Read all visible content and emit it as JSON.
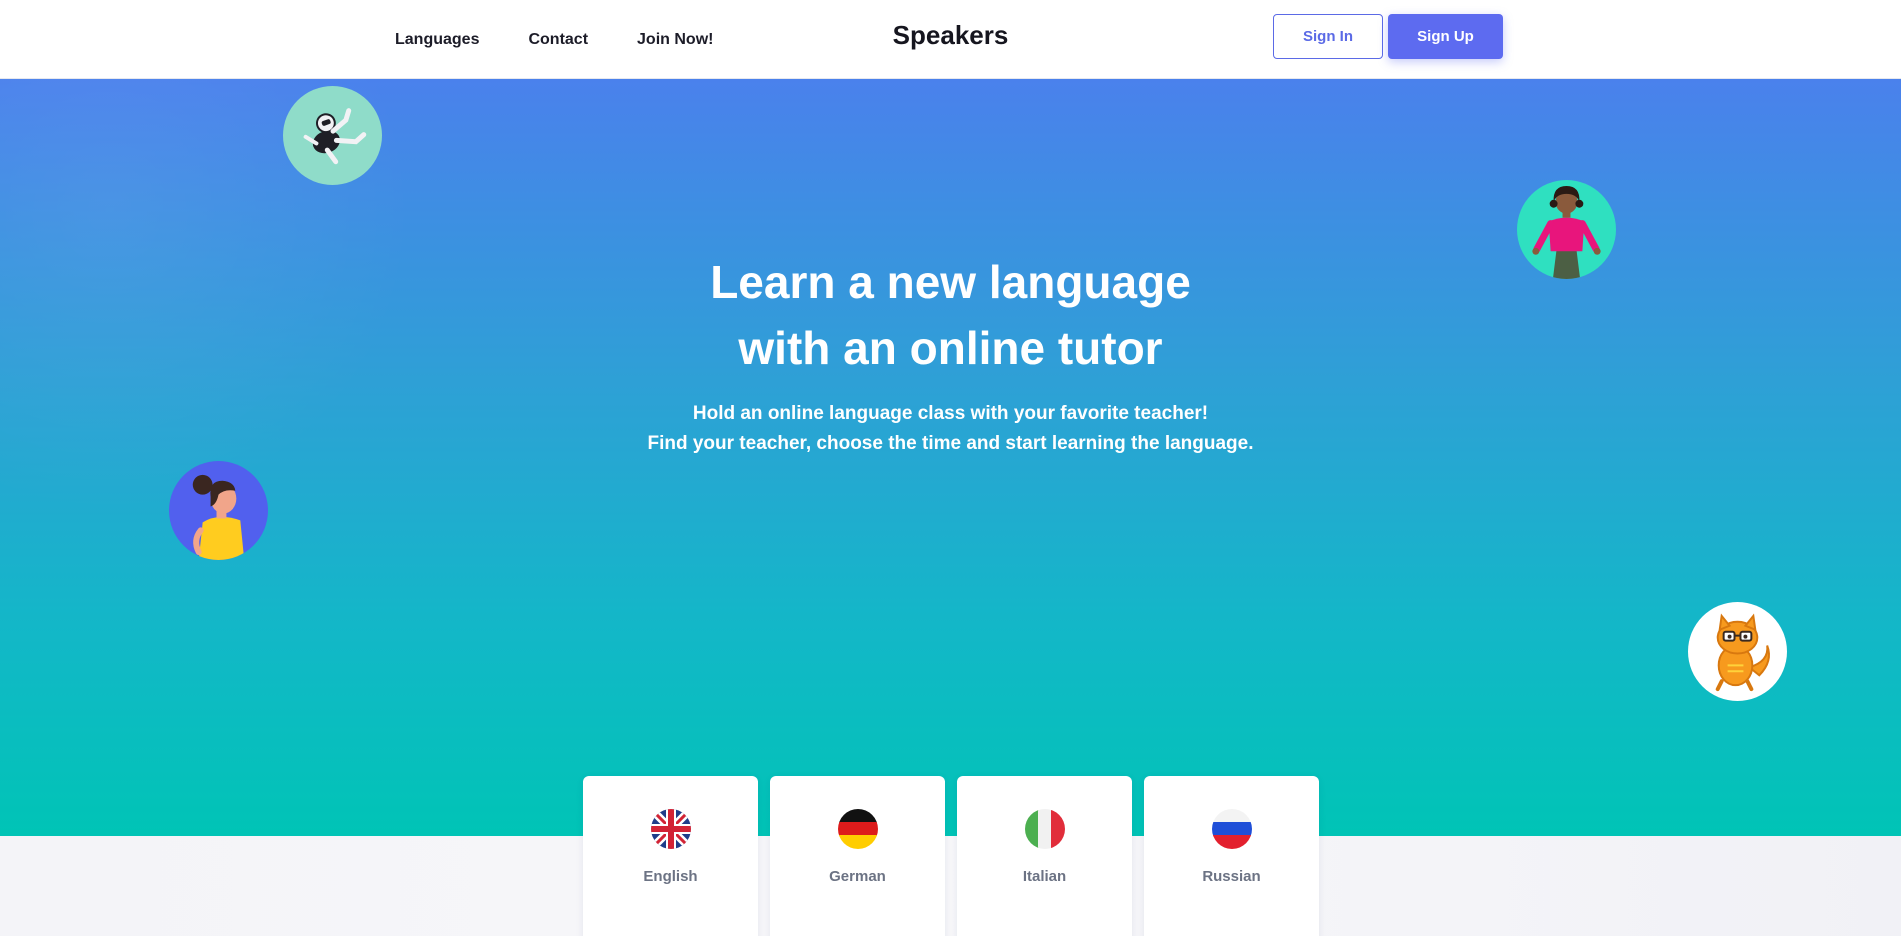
{
  "nav": {
    "links": [
      "Languages",
      "Contact",
      "Join Now!"
    ],
    "brand": "Speakers",
    "sign_in": "Sign In",
    "sign_up": "Sign Up"
  },
  "hero": {
    "title_line1": "Learn a new language",
    "title_line2": "with an online tutor",
    "subtitle_line1": "Hold an online language class with your favorite teacher!",
    "subtitle_line2": "Find your teacher, choose the time and start learning the language."
  },
  "languages": [
    {
      "name": "English",
      "flag": "uk-flag-icon"
    },
    {
      "name": "German",
      "flag": "germany-flag-icon"
    },
    {
      "name": "Italian",
      "flag": "italy-flag-icon"
    },
    {
      "name": "Russian",
      "flag": "russia-flag-icon"
    }
  ],
  "colors": {
    "accent": "#5d6bf0",
    "hero_top": "#4a81ec",
    "hero_bottom": "#00c4b6"
  }
}
